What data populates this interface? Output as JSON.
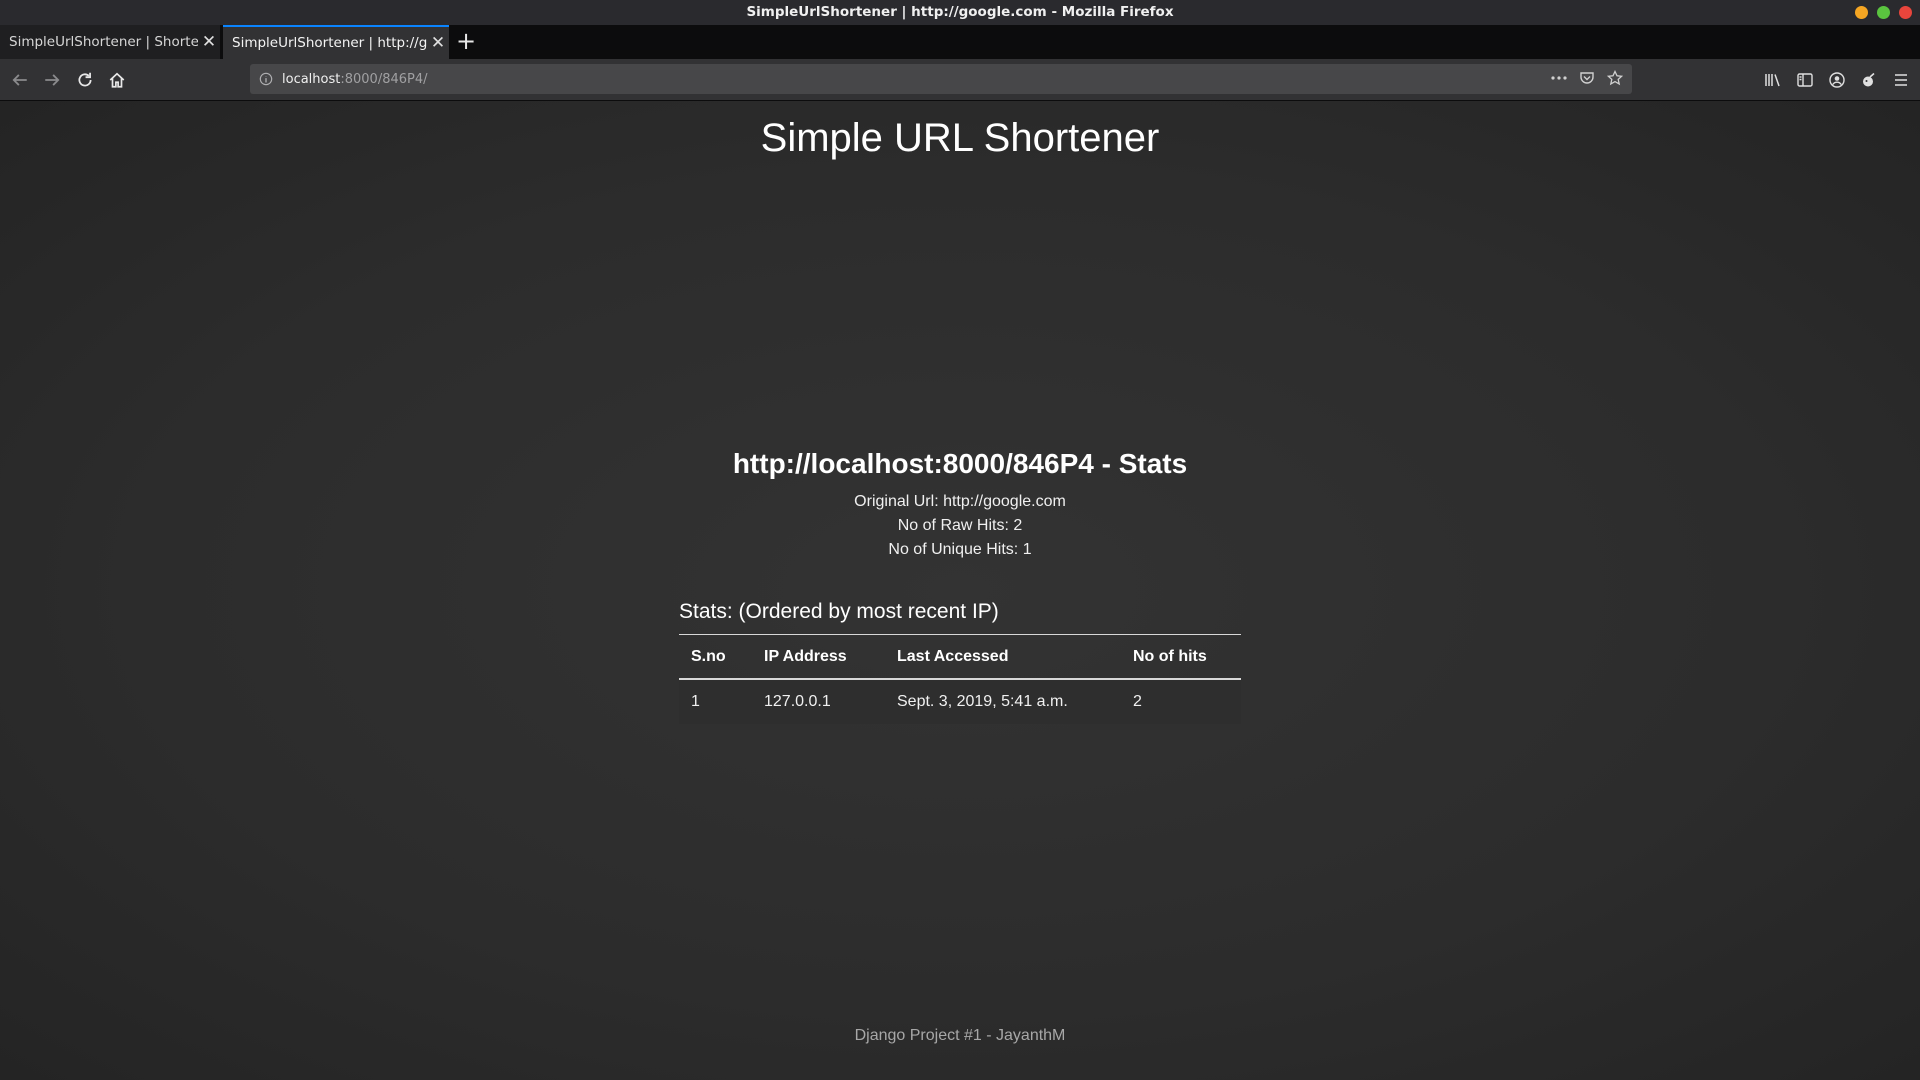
{
  "window": {
    "title": "SimpleUrlShortener | http://google.com - Mozilla Firefox",
    "controls": {
      "minimize_color": "#f5a623",
      "maximize_color": "#5ac43f",
      "close_color": "#e8453c"
    }
  },
  "tabs": [
    {
      "title": "SimpleUrlShortener | Shortener",
      "active": false
    },
    {
      "title": "SimpleUrlShortener | http://google.com",
      "active": true
    }
  ],
  "new_tab_label": "+",
  "close_glyph": "✕",
  "urlbar": {
    "host": "localhost",
    "path": ":8000/846P4/",
    "info_icon": "info-icon"
  },
  "icons": {
    "nav": [
      "back-arrow-icon",
      "forward-arrow-icon",
      "reload-icon",
      "home-icon"
    ],
    "url_actions": [
      "page-actions-icon",
      "pocket-icon",
      "bookmark-star-icon"
    ],
    "toolbar": [
      "library-icon",
      "sidebar-icon",
      "account-icon",
      "extension-icon",
      "menu-icon"
    ]
  },
  "colors": {
    "accent": "#0a84ff",
    "page_bg": "#2b2b2b",
    "text": "#ffffff"
  },
  "page": {
    "site_title": "Simple URL Shortener",
    "stats_heading": "http://localhost:8000/846P4 - Stats",
    "original_url": "Original Url: http://google.com",
    "raw_hits": "No of Raw Hits: 2",
    "unique_hits": "No of Unique Hits: 1",
    "table_caption": "Stats: (Ordered by most recent IP)",
    "table": {
      "headers": [
        "S.no",
        "IP Address",
        "Last Accessed",
        "No of hits"
      ],
      "rows": [
        [
          "1",
          "127.0.0.1",
          "Sept. 3, 2019, 5:41 a.m.",
          "2"
        ]
      ]
    },
    "footer": "Django Project #1 - JayanthM"
  }
}
